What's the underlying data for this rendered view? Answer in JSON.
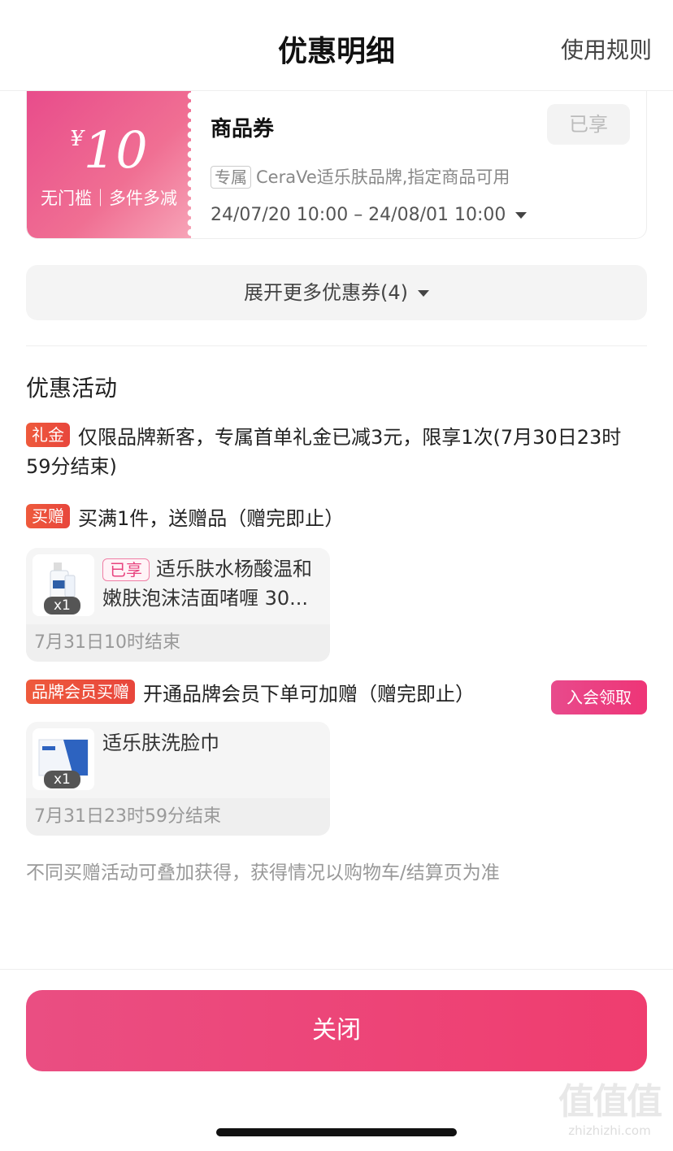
{
  "header": {
    "title": "优惠明细",
    "rules_link": "使用规则"
  },
  "coupon": {
    "currency": "¥",
    "amount": "10",
    "condition": "无门槛｜多件多减",
    "name": "商品券",
    "status": "已享",
    "scope_tag": "专属",
    "scope_text": "CeraVe适乐肤品牌,指定商品可用",
    "validity": "24/07/20 10:00 – 24/08/01 10:00"
  },
  "expand_more": "展开更多优惠券(4)",
  "activities": {
    "title": "优惠活动",
    "items": [
      {
        "badge": "礼金",
        "text": "仅限品牌新客，专属首单礼金已减3元，限享1次(7月30日23时59分结束)"
      },
      {
        "badge": "买赠",
        "text": "买满1件，送赠品（赠完即止）",
        "gift": {
          "owned_tag": "已享",
          "name": "适乐肤水杨酸温和嫩肤泡沫洁面啫喱 30...",
          "qty": "x1",
          "end": "7月31日10时结束"
        }
      },
      {
        "badge": "品牌会员买赠",
        "text": "开通品牌会员下单可加赠（赠完即止）",
        "action": "入会领取",
        "gift": {
          "name": "适乐肤洗脸巾",
          "qty": "x1",
          "end": "7月31日23时59分结束"
        }
      }
    ],
    "note": "不同买赠活动可叠加获得，获得情况以购物车/结算页为准"
  },
  "close_button": "关闭",
  "watermark": {
    "logo": "值值值",
    "site": "zhizhizhi.com"
  },
  "colors": {
    "accent": "#ee3d78",
    "badge": "#ea4e3c",
    "coupon_gradient_start": "#e84c8b"
  }
}
